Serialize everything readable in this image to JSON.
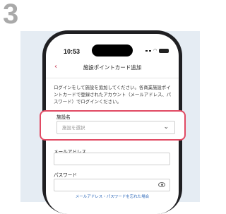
{
  "step_number": "3",
  "status_bar": {
    "time": "10:53"
  },
  "nav": {
    "back_icon": "chevron-left",
    "title": "施設ポイントカード追加"
  },
  "description": "ログインをして施設を追加してください。各商業施設ポイントカードで登録されたアカウント（メールアドレス、パスワード）でログインください。",
  "facility": {
    "label": "施設名",
    "placeholder": "施設を選択",
    "chevron_icon": "chevron-down"
  },
  "email": {
    "label": "メールアドレス"
  },
  "password": {
    "label": "パスワード",
    "eye_icon": "eye"
  },
  "forgot_link": "メールアドレス・パスワードを忘れた場合",
  "colors": {
    "accent": "#e14a63",
    "link": "#2a66b8",
    "panel": "#e5ecf3"
  }
}
